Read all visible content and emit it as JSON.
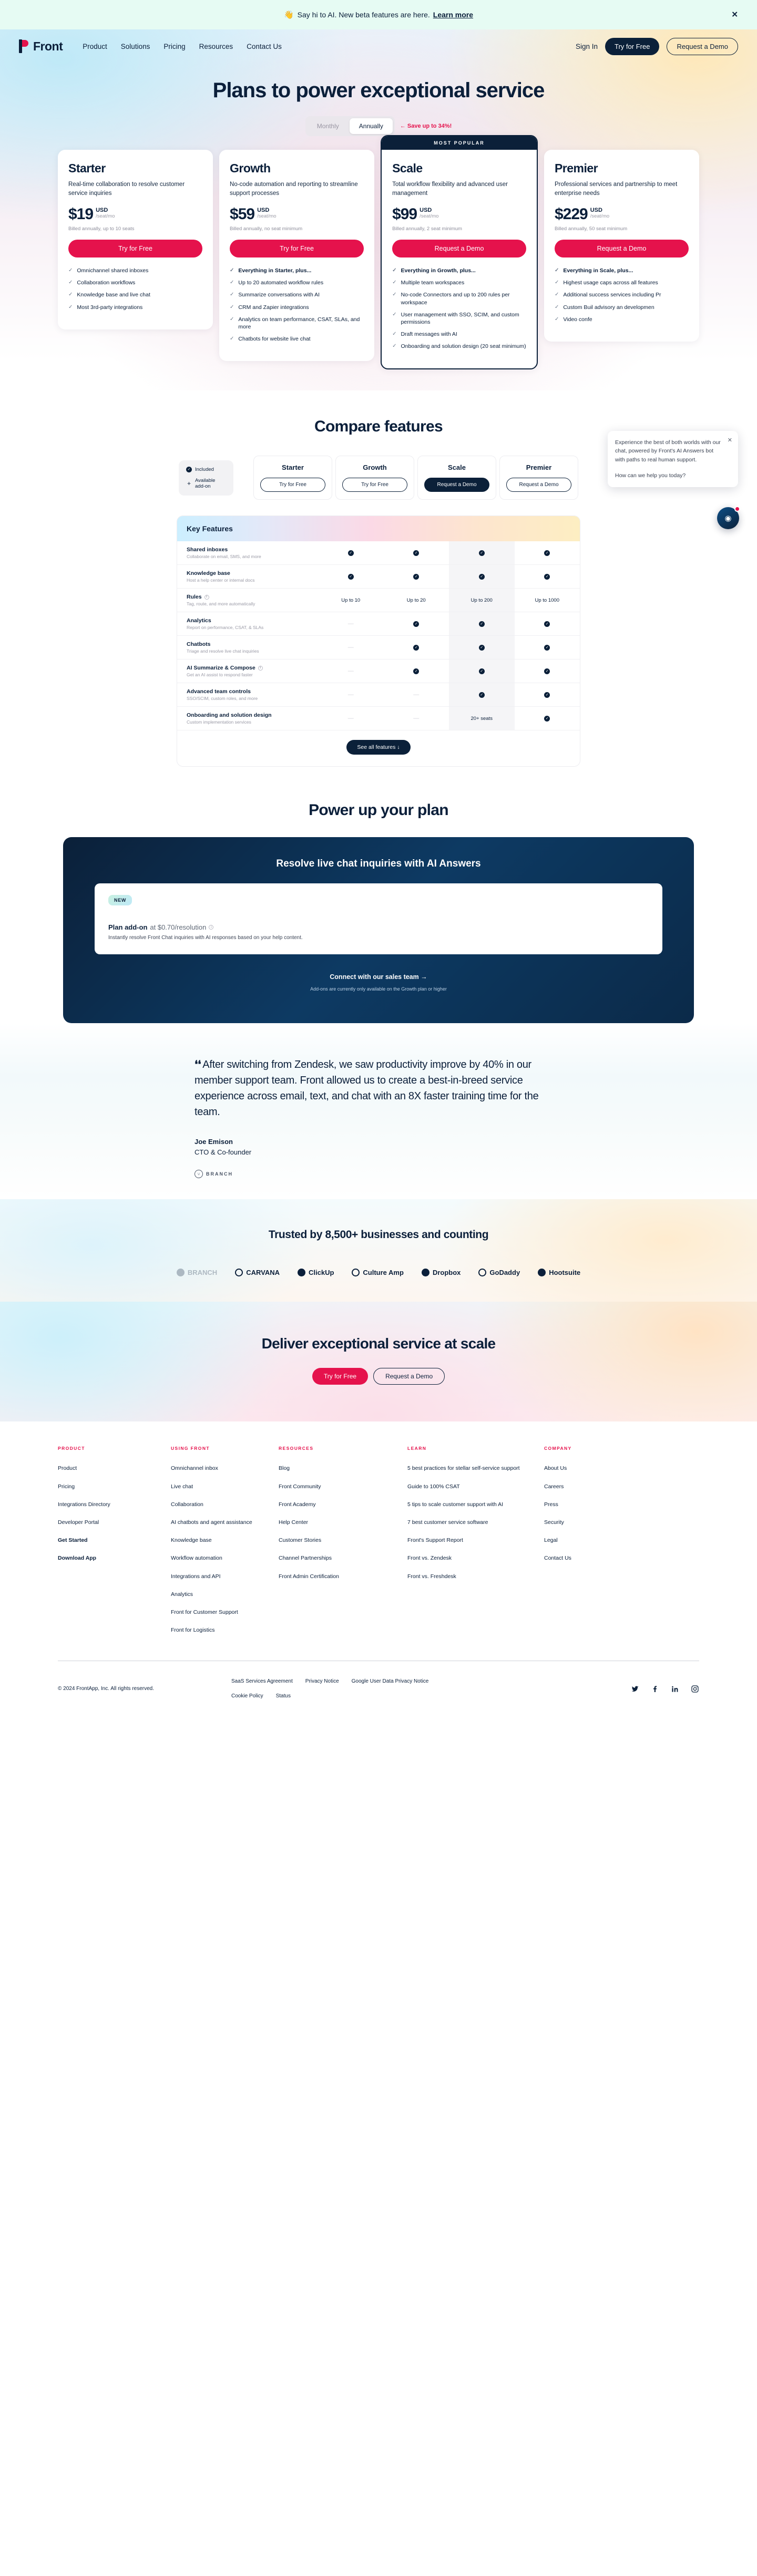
{
  "announcement": {
    "icon": "waving-hand-icon",
    "text": "Say hi to AI. New beta features are here.",
    "link": "Learn more",
    "close": "✕"
  },
  "nav": {
    "brand": "Front",
    "links": [
      "Product",
      "Solutions",
      "Pricing",
      "Resources",
      "Contact Us"
    ],
    "sign_in": "Sign In",
    "try_free": "Try for Free",
    "request_demo": "Request a Demo"
  },
  "hero": {
    "title": "Plans to power exceptional service",
    "billing_toggle": {
      "monthly": "Monthly",
      "annually": "Annually",
      "selected": "Annually"
    },
    "save_note": "← Save up to 34%!"
  },
  "plans": [
    {
      "name": "Starter",
      "description": "Real-time collaboration to resolve customer service inquiries",
      "price": "$19",
      "currency": "USD",
      "per": "/seat/mo",
      "billed": "Billed annually, up to 10 seats",
      "cta": "Try for Free",
      "popular": false,
      "badge": "",
      "features": [
        {
          "text": "Omnichannel shared inboxes",
          "bold": false
        },
        {
          "text": "Collaboration workflows",
          "bold": false
        },
        {
          "text": "Knowledge base and live chat",
          "bold": false
        },
        {
          "text": "Most 3rd-party integrations",
          "bold": false
        }
      ]
    },
    {
      "name": "Growth",
      "description": "No-code automation and reporting to streamline support processes",
      "price": "$59",
      "currency": "USD",
      "per": "/seat/mo",
      "billed": "Billed annually, no seat minimum",
      "cta": "Try for Free",
      "popular": false,
      "badge": "",
      "features": [
        {
          "text": "Everything in Starter, plus...",
          "bold": true
        },
        {
          "text": "Up to 20 automated workflow rules",
          "bold": false
        },
        {
          "text": "Summarize conversations with AI",
          "bold": false
        },
        {
          "text": "CRM and Zapier integrations",
          "bold": false
        },
        {
          "text": "Analytics on team performance, CSAT, SLAs, and more",
          "bold": false
        },
        {
          "text": "Chatbots for website live chat",
          "bold": false
        }
      ]
    },
    {
      "name": "Scale",
      "description": "Total workflow flexibility and advanced user management",
      "price": "$99",
      "currency": "USD",
      "per": "/seat/mo",
      "billed": "Billed annually, 2 seat minimum",
      "cta": "Request a Demo",
      "popular": true,
      "badge": "MOST POPULAR",
      "features": [
        {
          "text": "Everything in Growth, plus...",
          "bold": true
        },
        {
          "text": "Multiple team workspaces",
          "bold": false
        },
        {
          "text": "No-code Connectors and up to 200 rules per workspace",
          "bold": false
        },
        {
          "text": "User management with SSO, SCIM, and custom permissions",
          "bold": false
        },
        {
          "text": "Draft messages with AI",
          "bold": false
        },
        {
          "text": "Onboarding and solution design (20 seat minimum)",
          "bold": false
        }
      ]
    },
    {
      "name": "Premier",
      "description": "Professional services and partnership to meet enterprise needs",
      "price": "$229",
      "currency": "USD",
      "per": "/seat/mo",
      "billed": "Billed annually, 50 seat minimum",
      "cta": "Request a Demo",
      "popular": false,
      "badge": "",
      "features": [
        {
          "text": "Everything in Scale, plus...",
          "bold": true
        },
        {
          "text": "Highest usage caps across all features",
          "bold": false
        },
        {
          "text": "Additional success services including Pr",
          "bold": false
        },
        {
          "text": "Custom Buil advisory an developmen",
          "bold": false
        },
        {
          "text": "Video confe",
          "bold": false
        }
      ]
    }
  ],
  "compare": {
    "title": "Compare features",
    "legend": {
      "included": "Included",
      "addon": "Available add-on"
    },
    "columns": [
      {
        "name": "Starter",
        "cta": "Try for Free",
        "solid": false
      },
      {
        "name": "Growth",
        "cta": "Try for Free",
        "solid": false
      },
      {
        "name": "Scale",
        "cta": "Request a Demo",
        "solid": true
      },
      {
        "name": "Premier",
        "cta": "Request a Demo",
        "solid": false
      }
    ],
    "table_title": "Key Features",
    "rows": [
      {
        "name": "Shared inboxes",
        "sub": "Collaborate on email, SMS, and more",
        "info": false,
        "values": [
          "check",
          "check",
          "check",
          "check"
        ]
      },
      {
        "name": "Knowledge base",
        "sub": "Host a help center or internal docs",
        "info": false,
        "values": [
          "check",
          "check",
          "check",
          "check"
        ]
      },
      {
        "name": "Rules",
        "sub": "Tag, route, and more automatically",
        "info": true,
        "values": [
          "Up to 10",
          "Up to 20",
          "Up to 200",
          "Up to 1000"
        ]
      },
      {
        "name": "Analytics",
        "sub": "Report on performance, CSAT, & SLAs",
        "info": false,
        "values": [
          "dash",
          "check",
          "check",
          "check"
        ]
      },
      {
        "name": "Chatbots",
        "sub": "Triage and resolve live chat inquiries",
        "info": false,
        "values": [
          "dash",
          "check",
          "check",
          "check"
        ]
      },
      {
        "name": "AI Summarize & Compose",
        "sub": "Get an AI assist to respond faster",
        "info": true,
        "values": [
          "dash",
          "check",
          "check",
          "check"
        ]
      },
      {
        "name": "Advanced team controls",
        "sub": "SSO/SCIM, custom roles, and more",
        "info": false,
        "values": [
          "dash",
          "dash",
          "check",
          "check"
        ]
      },
      {
        "name": "Onboarding and solution design",
        "sub": "Custom implementation services",
        "info": false,
        "values": [
          "dash",
          "dash",
          "20+ seats",
          "check"
        ]
      }
    ],
    "see_all": "See all features ↓"
  },
  "powerup": {
    "title": "Power up your plan",
    "card_title": "Resolve live chat inquiries with AI Answers",
    "new_badge": "NEW",
    "addon_label": "Plan add-on",
    "addon_price": "at $0.70/resolution",
    "addon_desc": "Instantly resolve Front Chat inquiries with AI responses based on your help content.",
    "connect": "Connect with our sales team →",
    "note": "Add-ons are currently only available on the Growth plan or higher"
  },
  "testimonial": {
    "quote": "After switching from Zendesk, we saw productivity improve by 40% in our member support team. Front allowed us to create a best-in-breed service experience across email, text, and chat with an 8X faster training time for the team.",
    "name": "Joe Emison",
    "role": "CTO & Co-founder",
    "company": "BRANCH"
  },
  "trusted": {
    "title": "Trusted by 8,500+ businesses and counting",
    "logos": [
      "BRANCH",
      "CARVANA",
      "ClickUp",
      "Culture Amp",
      "Dropbox",
      "GoDaddy",
      "Hootsuite"
    ]
  },
  "final_cta": {
    "title": "Deliver exceptional service at scale",
    "try_free": "Try for Free",
    "request_demo": "Request a Demo"
  },
  "footer": {
    "columns": [
      {
        "heading": "PRODUCT",
        "links": [
          {
            "text": "Product",
            "bold": false
          },
          {
            "text": "Pricing",
            "bold": false
          },
          {
            "text": "Integrations Directory",
            "bold": false
          },
          {
            "text": "Developer Portal",
            "bold": false
          },
          {
            "text": "Get Started",
            "bold": true
          },
          {
            "text": "Download App",
            "bold": true
          }
        ]
      },
      {
        "heading": "USING FRONT",
        "links": [
          {
            "text": "Omnichannel inbox",
            "bold": false
          },
          {
            "text": "Live chat",
            "bold": false
          },
          {
            "text": "Collaboration",
            "bold": false
          },
          {
            "text": "AI chatbots and agent assistance",
            "bold": false
          },
          {
            "text": "Knowledge base",
            "bold": false
          },
          {
            "text": "Workflow automation",
            "bold": false
          },
          {
            "text": "Integrations and API",
            "bold": false
          },
          {
            "text": "Analytics",
            "bold": false
          },
          {
            "text": "Front for Customer Support",
            "bold": false
          },
          {
            "text": "Front for Logistics",
            "bold": false
          }
        ]
      },
      {
        "heading": "RESOURCES",
        "links": [
          {
            "text": "Blog",
            "bold": false
          },
          {
            "text": "Front Community",
            "bold": false
          },
          {
            "text": "Front Academy",
            "bold": false
          },
          {
            "text": "Help Center",
            "bold": false
          },
          {
            "text": "Customer Stories",
            "bold": false
          },
          {
            "text": "Channel Partnerships",
            "bold": false
          },
          {
            "text": "Front Admin Certification",
            "bold": false
          }
        ]
      },
      {
        "heading": "LEARN",
        "links": [
          {
            "text": "5 best practices for stellar self-service support",
            "bold": false
          },
          {
            "text": "Guide to 100% CSAT",
            "bold": false
          },
          {
            "text": "5 tips to scale customer support with AI",
            "bold": false
          },
          {
            "text": "7 best customer service software",
            "bold": false
          },
          {
            "text": "Front's Support Report",
            "bold": false
          },
          {
            "text": "Front vs. Zendesk",
            "bold": false
          },
          {
            "text": "Front vs. Freshdesk",
            "bold": false
          }
        ]
      },
      {
        "heading": "COMPANY",
        "links": [
          {
            "text": "About Us",
            "bold": false
          },
          {
            "text": "Careers",
            "bold": false
          },
          {
            "text": "Press",
            "bold": false
          },
          {
            "text": "Security",
            "bold": false
          },
          {
            "text": "Legal",
            "bold": false
          },
          {
            "text": "Contact Us",
            "bold": false
          }
        ]
      }
    ],
    "copyright": "© 2024 FrontApp, Inc. All rights reserved.",
    "legal": [
      "SaaS Services Agreement",
      "Privacy Notice",
      "Google User Data Privacy Notice",
      "Cookie Policy",
      "Status"
    ],
    "socials": [
      "twitter-icon",
      "facebook-icon",
      "linkedin-icon",
      "instagram-icon"
    ]
  },
  "chat_widget": {
    "message": "Experience the best of both worlds with our chat, powered by Front's AI Answers bot with paths to real human support.",
    "prompt": "How can we help you today?",
    "close": "✕"
  }
}
